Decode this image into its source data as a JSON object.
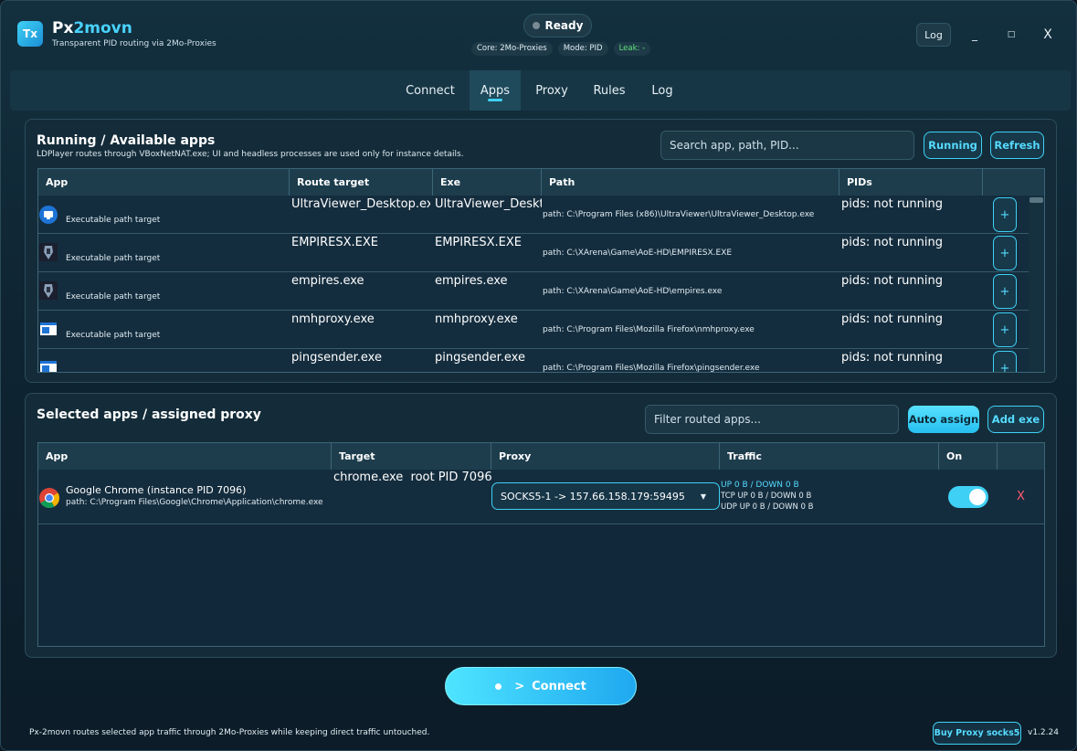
{
  "header": {
    "logo_text": "Tx",
    "title_part1": "Px",
    "title_part2": "2movn",
    "subtitle": "Transparent PID routing via 2Mo-Proxies",
    "status": "Ready",
    "core": "Core: 2Mo-Proxies",
    "mode": "Mode: PID",
    "leak": "Leak: -",
    "log_label": "Log",
    "minimize": "_",
    "maximize": "□",
    "close": "X"
  },
  "tabs": [
    {
      "label": "Connect"
    },
    {
      "label": "Apps"
    },
    {
      "label": "Proxy"
    },
    {
      "label": "Rules"
    },
    {
      "label": "Log"
    }
  ],
  "running": {
    "title": "Running / Available apps",
    "subtitle": "LDPlayer routes through VBoxNetNAT.exe; UI and headless processes are used only for instance details.",
    "search_placeholder": "Search app, path, PID...",
    "running_label": "Running",
    "refresh_label": "Refresh",
    "columns": [
      "App",
      "Route target",
      "Exe",
      "Path",
      "PIDs"
    ],
    "rows": [
      {
        "icon": "ultraviewer-icon",
        "note": "Executable path target",
        "route": "UltraViewer_Desktop.exe",
        "exe": "UltraViewer_Desktop",
        "path": "path: C:\\Program Files (x86)\\UltraViewer\\UltraViewer_Desktop.exe",
        "pids": "pids: not running"
      },
      {
        "icon": "empires-icon",
        "note": "Executable path target",
        "route": "EMPIRESX.EXE",
        "exe": "EMPIRESX.EXE",
        "path": "path: C:\\XArena\\Game\\AoE-HD\\EMPIRESX.EXE",
        "pids": "pids: not running"
      },
      {
        "icon": "empires-icon",
        "note": "Executable path target",
        "route": "empires.exe",
        "exe": "empires.exe",
        "path": "path: C:\\XArena\\Game\\AoE-HD\\empires.exe",
        "pids": "pids: not running"
      },
      {
        "icon": "window-icon",
        "note": "Executable path target",
        "route": "nmhproxy.exe",
        "exe": "nmhproxy.exe",
        "path": "path: C:\\Program Files\\Mozilla Firefox\\nmhproxy.exe",
        "pids": "pids: not running"
      },
      {
        "icon": "window-icon",
        "note": "",
        "route": "pingsender.exe",
        "exe": "pingsender.exe",
        "path": "path: C:\\Program Files\\Mozilla Firefox\\pingsender.exe",
        "pids": "pids: not running"
      }
    ],
    "add_label": "+"
  },
  "selected": {
    "title": "Selected apps / assigned proxy",
    "filter_placeholder": "Filter routed apps...",
    "auto_assign_label": "Auto assign",
    "add_exe_label": "Add exe",
    "columns": [
      "App",
      "Target",
      "Proxy",
      "Traffic",
      "On"
    ],
    "rows": [
      {
        "name": "Google Chrome (instance PID 7096)",
        "path": "path: C:\\Program Files\\Google\\Chrome\\Application\\chrome.exe",
        "target": "chrome.exe  root PID 7096",
        "proxy": "SOCKS5-1 -> 157.66.158.179:59495",
        "traffic_main": "UP 0 B / DOWN 0 B",
        "traffic_tcp": "TCP UP 0 B / DOWN 0 B",
        "traffic_udp": "UDP UP 0 B / DOWN 0 B",
        "on": true,
        "remove": "X"
      }
    ]
  },
  "connect": {
    "arrow": ">",
    "label": "Connect"
  },
  "footer": {
    "text": "Px-2movn routes selected app traffic through 2Mo-Proxies while keeping direct traffic untouched.",
    "buy_label": "Buy Proxy socks5",
    "version": "v1.2.24"
  },
  "colors": {
    "accent": "#3fd1f5",
    "danger": "#ff5a6e",
    "leak_ok": "#5fe37a"
  }
}
